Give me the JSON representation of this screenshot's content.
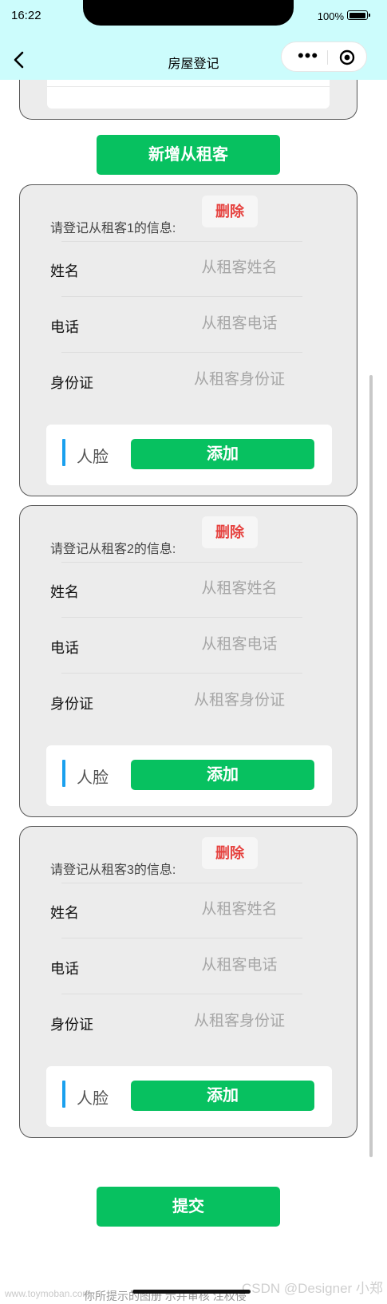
{
  "status_bar": {
    "time": "16:22",
    "battery": "100%"
  },
  "nav": {
    "title": "房屋登记"
  },
  "buttons": {
    "add_tenant": "新增从租客",
    "submit": "提交"
  },
  "tenants": [
    {
      "title": "请登记从租客1的信息:",
      "delete": "删除",
      "fields": {
        "name_label": "姓名",
        "name_placeholder": "从租客姓名",
        "phone_label": "电话",
        "phone_placeholder": "从租客电话",
        "id_label": "身份证",
        "id_placeholder": "从租客身份证"
      },
      "face": {
        "label": "人脸",
        "add": "添加"
      }
    },
    {
      "title": "请登记从租客2的信息:",
      "delete": "删除",
      "fields": {
        "name_label": "姓名",
        "name_placeholder": "从租客姓名",
        "phone_label": "电话",
        "phone_placeholder": "从租客电话",
        "id_label": "身份证",
        "id_placeholder": "从租客身份证"
      },
      "face": {
        "label": "人脸",
        "add": "添加"
      }
    },
    {
      "title": "请登记从租客3的信息:",
      "delete": "删除",
      "fields": {
        "name_label": "姓名",
        "name_placeholder": "从租客姓名",
        "phone_label": "电话",
        "phone_placeholder": "从租客电话",
        "id_label": "身份证",
        "id_placeholder": "从租客身份证"
      },
      "face": {
        "label": "人脸",
        "add": "添加"
      }
    }
  ],
  "footer": {
    "tip": "你所提示的图册 示并审核  注权侵",
    "watermark_left": "www.toymoban.com",
    "watermark_right": "CSDN @Designer 小郑"
  },
  "colors": {
    "accent": "#07c160",
    "danger": "#e64340",
    "nav_bg": "#ccfcfc",
    "card_bg": "#ececec",
    "face_bar": "#1aa0ee"
  }
}
